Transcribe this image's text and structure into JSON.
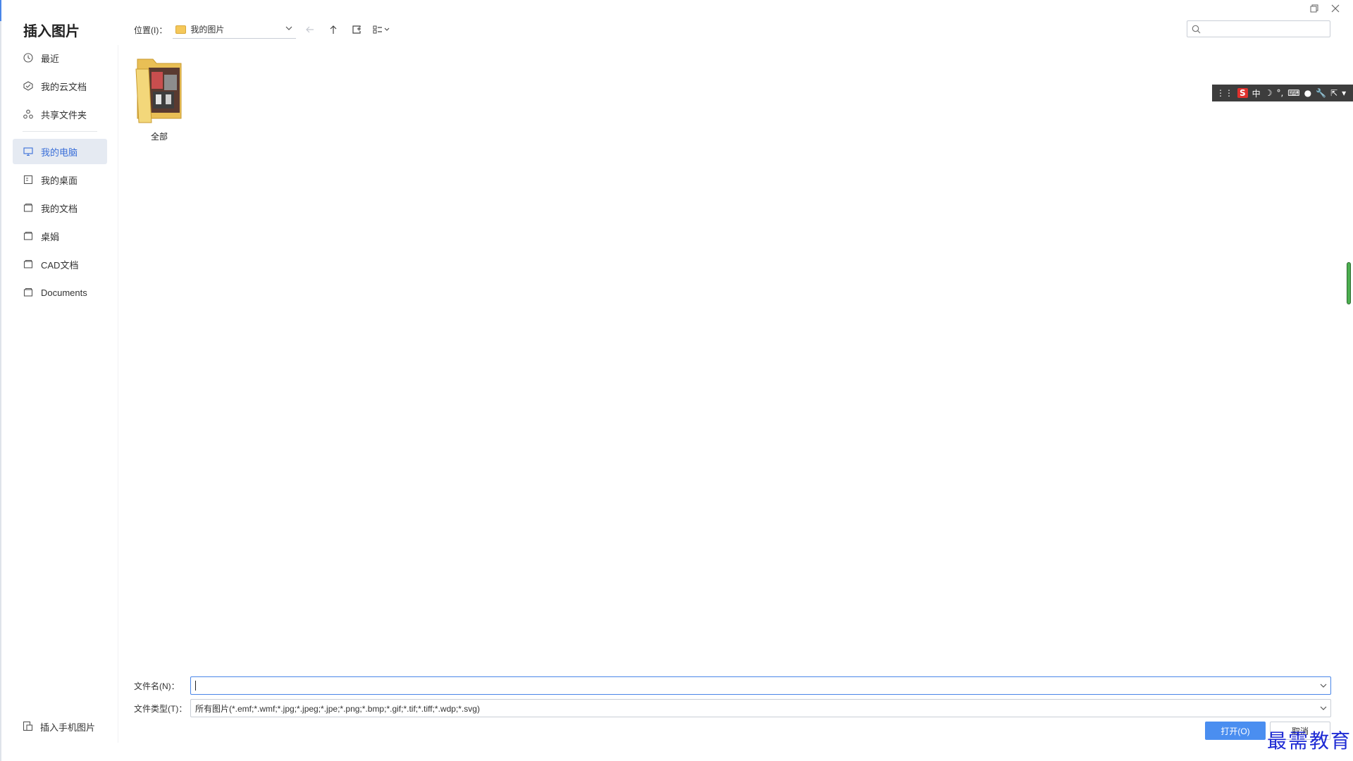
{
  "dialog": {
    "title": "插入图片"
  },
  "sidebar": {
    "items": [
      {
        "label": "最近",
        "icon": "clock-icon"
      },
      {
        "label": "我的云文档",
        "icon": "cloud-doc-icon"
      },
      {
        "label": "共享文件夹",
        "icon": "share-icon"
      },
      {
        "label": "我的电脑",
        "icon": "monitor-icon",
        "active": true
      },
      {
        "label": "我的桌面",
        "icon": "desktop-icon"
      },
      {
        "label": "我的文档",
        "icon": "folder-icon"
      },
      {
        "label": "桌娟",
        "icon": "folder-icon"
      },
      {
        "label": "CAD文档",
        "icon": "folder-icon"
      },
      {
        "label": "Documents",
        "icon": "folder-icon"
      }
    ],
    "bottom_label": "插入手机图片"
  },
  "toolbar": {
    "location_label": "位置(I)：",
    "location_value": "我的图片"
  },
  "search": {
    "placeholder": ""
  },
  "ime": {
    "label": "中"
  },
  "files": [
    {
      "name": "全部"
    }
  ],
  "footer": {
    "filename_label": "文件名(N)：",
    "filename_value": "",
    "filetype_label": "文件类型(T)：",
    "filetype_value": "所有图片(*.emf;*.wmf;*.jpg;*.jpeg;*.jpe;*.png;*.bmp;*.gif;*.tif;*.tiff;*.wdp;*.svg)",
    "open_label": "打开(O)",
    "cancel_label": "取消"
  },
  "watermark": "最需教育",
  "colors": {
    "accent": "#4a8ef0",
    "active_bg": "#e5eaf2",
    "active_text": "#3a6fd8",
    "watermark": "#1f2bd4"
  }
}
